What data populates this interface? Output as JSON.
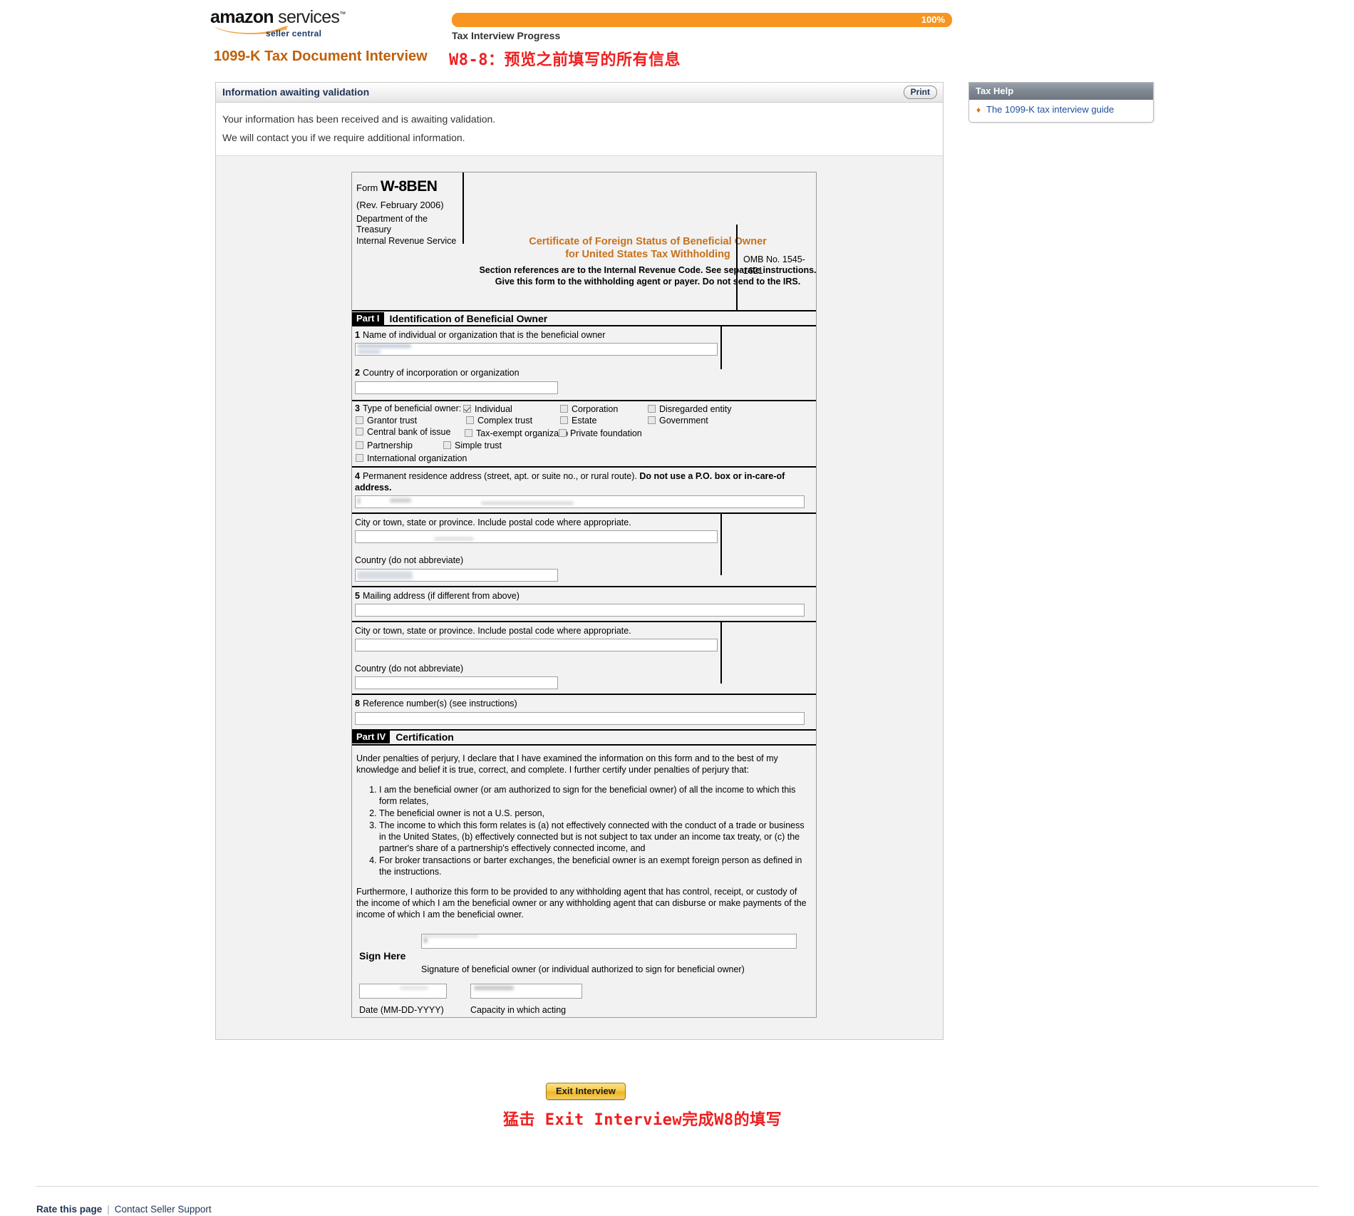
{
  "brand": {
    "logo_main": "amazon",
    "logo_services": "services",
    "logo_sub": "seller central"
  },
  "progress": {
    "percent_label": "100%",
    "percent_value": 100,
    "caption": "Tax Interview Progress",
    "bar_color": "#f79520"
  },
  "header": {
    "page_title": "1099-K Tax Document Interview",
    "title_color": "#c0600a",
    "annotation": "W8-8：预览之前填写的所有信息",
    "annotation_color": "#ef1f1f"
  },
  "panel": {
    "title": "Information awaiting validation",
    "print_label": "Print",
    "line1": "Your information has been received and is awaiting validation.",
    "line2": "We will contact you if we require additional information."
  },
  "tax_help": {
    "header": "Tax Help",
    "bullet_glyph": "♦",
    "items": [
      {
        "label": "The 1099-K tax interview guide"
      }
    ]
  },
  "form": {
    "form_word": "Form",
    "form_number": "W-8BEN",
    "revision": "(Rev. February 2006)",
    "department": "Department of the Treasury",
    "agency": "Internal Revenue Service",
    "cert_title_line1": "Certificate of Foreign Status of Beneficial Owner",
    "cert_title_line2": "for United States Tax Withholding",
    "section_ref": "Section references are to the Internal Revenue Code. See separate instructions.",
    "give_form": "Give this form to the withholding agent or payer. Do not send to the IRS.",
    "omb": "OMB No. 1545-1621",
    "part1": {
      "tag": "Part I",
      "name": "Identification of Beneficial Owner",
      "line1_num": "1",
      "line1_label": "Name of individual or organization that is the beneficial owner",
      "line1_value": "",
      "line2_num": "2",
      "line2_label": "Country of incorporation or organization",
      "line2_value": "",
      "line3_num": "3",
      "line3_label": "Type of beneficial owner:",
      "checkboxes": [
        {
          "label": "Individual",
          "checked": true
        },
        {
          "label": "Corporation",
          "checked": false
        },
        {
          "label": "Disregarded entity",
          "checked": false
        },
        {
          "label": "Grantor trust",
          "checked": false
        },
        {
          "label": "Complex trust",
          "checked": false
        },
        {
          "label": "Estate",
          "checked": false
        },
        {
          "label": "Government",
          "checked": false
        },
        {
          "label": "Central bank of issue",
          "checked": false
        },
        {
          "label": "Tax-exempt organization",
          "checked": false
        },
        {
          "label": "Private foundation",
          "checked": false
        },
        {
          "label": "Partnership",
          "checked": false
        },
        {
          "label": "Simple trust",
          "checked": false
        },
        {
          "label": "International organization",
          "checked": false
        }
      ],
      "line4_num": "4",
      "line4_label_normal": "Permanent residence address (street, apt. or suite no., or rural route).",
      "line4_label_bold": "Do not use a P.O. box or in-care-of address.",
      "line4_value": "",
      "city_label": "City or town, state or province. Include postal code where appropriate.",
      "city_value": "",
      "country_label": "Country (do not abbreviate)",
      "country_value": "",
      "line5_num": "5",
      "line5_label": "Mailing address (if different from above)",
      "line5_value": "",
      "mail_city_label": "City or town, state or province. Include postal code where appropriate.",
      "mail_city_value": "",
      "mail_country_label": "Country (do not abbreviate)",
      "mail_country_value": "",
      "line8_num": "8",
      "line8_label": "Reference number(s) (see instructions)",
      "line8_value": ""
    },
    "part4": {
      "tag": "Part IV",
      "name": "Certification",
      "intro": "Under penalties of perjury, I declare that I have examined the information on this form and to the best of my knowledge and belief it is true, correct, and complete. I further certify under penalties of perjury that:",
      "items": [
        "I am the beneficial owner (or am authorized to sign for the beneficial owner) of all the income to which this form relates,",
        "The beneficial owner is not a U.S. person,",
        "The income to which this form relates is (a) not effectively connected with the conduct of a trade or business in the United States, (b) effectively connected but is not subject to tax under an income tax treaty, or (c) the partner's share of a partnership's effectively connected income, and",
        "For broker transactions or barter exchanges, the beneficial owner is an exempt foreign person as defined in the instructions."
      ],
      "furthermore": "Furthermore, I authorize this form to be provided to any withholding agent that has control, receipt, or custody of the income of which I am the beneficial owner or any withholding agent that can disburse or make payments of the income of which I am the beneficial owner.",
      "sign_here": "Sign Here",
      "signature_value": "",
      "signature_caption": "Signature of beneficial owner (or individual authorized to sign for beneficial owner)",
      "date_value": "",
      "capacity_value": "",
      "date_caption": "Date (MM-DD-YYYY)",
      "capacity_caption": "Capacity in which acting"
    }
  },
  "actions": {
    "exit_label": "Exit Interview",
    "annotation_bottom": "猛击 Exit Interview完成W8的填写"
  },
  "footer": {
    "rate_label": "Rate this page",
    "separator": "|",
    "contact_label": "Contact Seller Support"
  }
}
